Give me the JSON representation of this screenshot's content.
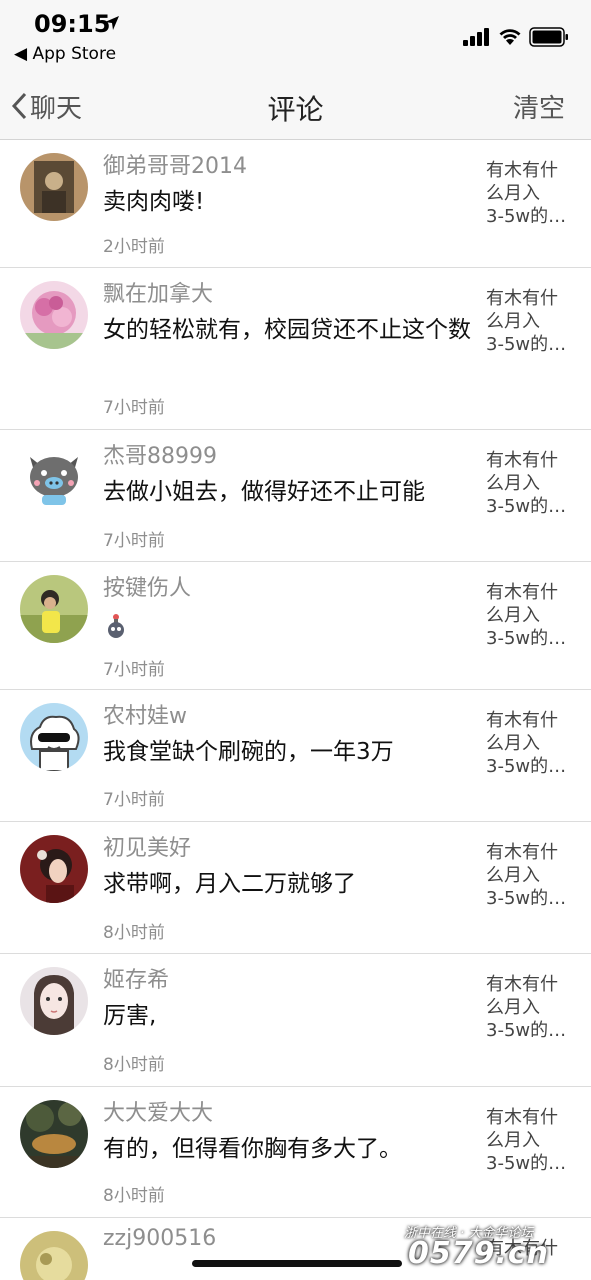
{
  "status_bar": {
    "time": "09:15",
    "back_app": "◀ App Store"
  },
  "nav": {
    "back_label": "聊天",
    "title": "评论",
    "clear_label": "清空"
  },
  "comments": [
    {
      "user": "御弟哥哥2014",
      "text": "卖肉肉喽!",
      "time": "2小时前",
      "ref": "有木有什\n么月入\n3-5w的…"
    },
    {
      "user": "飘在加拿大",
      "text": "女的轻松就有，校园贷还不止这个数",
      "time": "7小时前",
      "ref": "有木有什\n么月入\n3-5w的…"
    },
    {
      "user": "杰哥88999",
      "text": "去做小姐去，做得好还不止可能",
      "time": "7小时前",
      "ref": "有木有什\n么月入\n3-5w的…"
    },
    {
      "user": "按键伤人",
      "text": "",
      "time": "7小时前",
      "ref": "有木有什\n么月入\n3-5w的…"
    },
    {
      "user": "农村娃w",
      "text": "我食堂缺个刷碗的，一年3万",
      "time": "7小时前",
      "ref": "有木有什\n么月入\n3-5w的…"
    },
    {
      "user": "初见美好",
      "text": "求带啊，月入二万就够了",
      "time": "8小时前",
      "ref": "有木有什\n么月入\n3-5w的…"
    },
    {
      "user": "姬存希",
      "text": "厉害,",
      "time": "8小时前",
      "ref": "有木有什\n么月入\n3-5w的…"
    },
    {
      "user": "大大爱大大",
      "text": "有的，但得看你胸有多大了。",
      "time": "8小时前",
      "ref": "有木有什\n么月入\n3-5w的…"
    },
    {
      "user": "zzj900516",
      "text": "",
      "time": "",
      "ref": "有木有什"
    }
  ],
  "watermark": {
    "line1": "浙中在线 · 大金华论坛",
    "line2": "0579.cn"
  }
}
